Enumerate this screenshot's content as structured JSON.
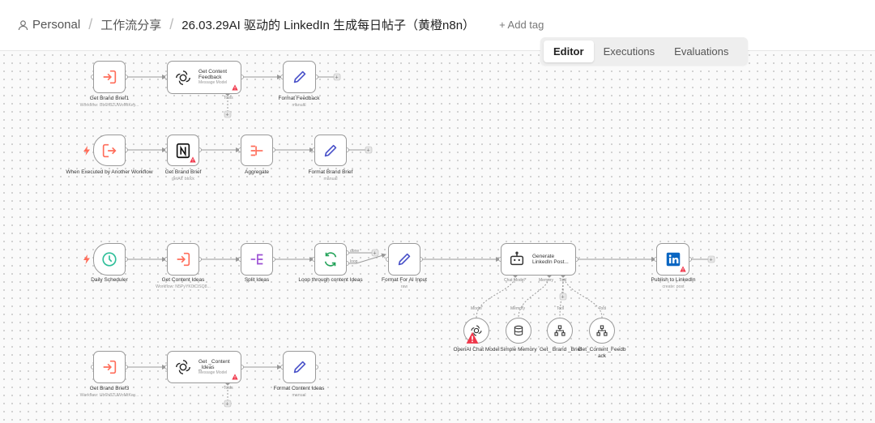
{
  "header": {
    "crumb_personal": "Personal",
    "crumb_folder": "工作流分享",
    "workflow_title": "26.03.29AI 驱动的 LinkedIn 生成每日帖子（黄橙n8n）",
    "add_tag": "+ Add tag",
    "tabs": [
      "Editor",
      "Executions",
      "Evaluations"
    ],
    "active_tab": "Editor"
  },
  "nodes": {
    "get_brand_brief1": {
      "label": "Get Brand Brief1",
      "sub": "Workflow: Ub6h8ZUWoMtKey...",
      "icon": "execute-workflow-icon"
    },
    "get_content_feedback": {
      "label": "Get Content Feedback",
      "sub": "Message Model",
      "icon": "openai-icon",
      "port": "Tools"
    },
    "format_feedback": {
      "label": "Format Feedback",
      "sub": "manual",
      "icon": "pen-icon"
    },
    "when_executed": {
      "label": "When Executed by Another Workflow",
      "icon": "workflow-trigger-icon"
    },
    "get_brand_brief": {
      "label": "Get Brand Brief",
      "sub": "getAll: block",
      "icon": "notion-icon"
    },
    "aggregate": {
      "label": "Aggregate",
      "icon": "aggregate-icon"
    },
    "format_brand_brief": {
      "label": "Format Brand Brief",
      "sub": "manual",
      "icon": "pen-icon"
    },
    "daily_scheduler": {
      "label": "Daily Scheduler",
      "icon": "clock-icon"
    },
    "get_content_ideas": {
      "label": "Get Content Ideas",
      "sub": "Workflow: N5PyYK0tCiSQ8...",
      "icon": "execute-workflow-icon"
    },
    "split_ideas": {
      "label": "Split Ideas",
      "icon": "split-icon"
    },
    "loop_ideas": {
      "label": "Loop through content Ideas",
      "icon": "loop-icon",
      "out_done": "done",
      "out_loop": "loop"
    },
    "format_ai_input": {
      "label": "Format For AI Input",
      "sub": "raw",
      "icon": "pen-icon"
    },
    "generate_post": {
      "label": "Generate LinkedIn Post...",
      "icon": "robot-icon",
      "ports": [
        "Chat Model*",
        "Memory",
        "Tool"
      ]
    },
    "publish_linkedin": {
      "label": "Publish to LinkedIn",
      "sub": "create: post",
      "icon": "linkedin-icon"
    },
    "openai_chat_model": {
      "label": "OpenAI Chat Model",
      "port": "Model"
    },
    "simple_memory": {
      "label": "Simple Memory",
      "port": "Memory"
    },
    "tool_brand_brief": {
      "label": "Get_ Brand _Brief",
      "port": "Tool"
    },
    "tool_content_feedback": {
      "label": "Get_Content_Feedback",
      "port": "Tool"
    },
    "get_brand_brief3": {
      "label": "Get Brand Brief3",
      "sub": "Workflow: Ub6h8ZUWoMtKey...",
      "icon": "execute-workflow-icon"
    },
    "get_content_ideas_model": {
      "label": "Get _Content _Ideas",
      "sub": "Message Model",
      "icon": "openai-icon",
      "port": "Tools"
    },
    "format_content_ideas": {
      "label": "Format Content Ideas",
      "sub": "manual",
      "icon": "pen-icon"
    }
  },
  "colors": {
    "accent_orange": "#ff6d5a",
    "pen": "#4b53c9",
    "clock": "#2fbf9a",
    "split": "#9b4fd4",
    "loop": "#24a35a",
    "linkedin": "#0a66c2",
    "warning": "#f0364a"
  }
}
